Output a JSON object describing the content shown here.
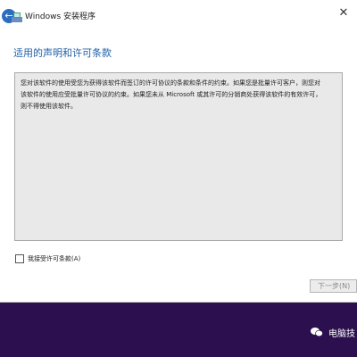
{
  "window": {
    "title": "Windows 安装程序"
  },
  "page": {
    "heading": "适用的声明和许可条款",
    "license_text": "您对该软件的使用受您为获得该软件而签订的许可协议的条款和条件的约束。如果您是批量许可客户，则您对该软件的使用应受批量许可协议的约束。如果您未从 Microsoft 或其许可的分销商处获得该软件的有效许可，则不得使用该软件。",
    "accept_label": "我接受许可条款(A)",
    "accept_checked": false,
    "next_button": "下一步(N)"
  },
  "watermark": {
    "icon": "wechat-icon",
    "text": "电脑技"
  },
  "colors": {
    "heading": "#1f5fa8",
    "desktop_bg": "#2b0f4f"
  }
}
